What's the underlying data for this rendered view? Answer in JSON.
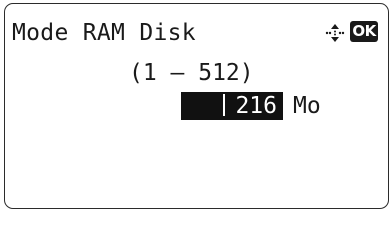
{
  "screen": {
    "title": "Mode RAM Disk",
    "range": "(1 – 512)",
    "value": "216",
    "unit": "Mo"
  },
  "icons": {
    "navigation": "four-way-arrow-icon",
    "ok": "OK"
  },
  "colors": {
    "background": "#ffffff",
    "text": "#1a1a1a",
    "highlight": "#111111",
    "highlight_text": "#ffffff"
  }
}
